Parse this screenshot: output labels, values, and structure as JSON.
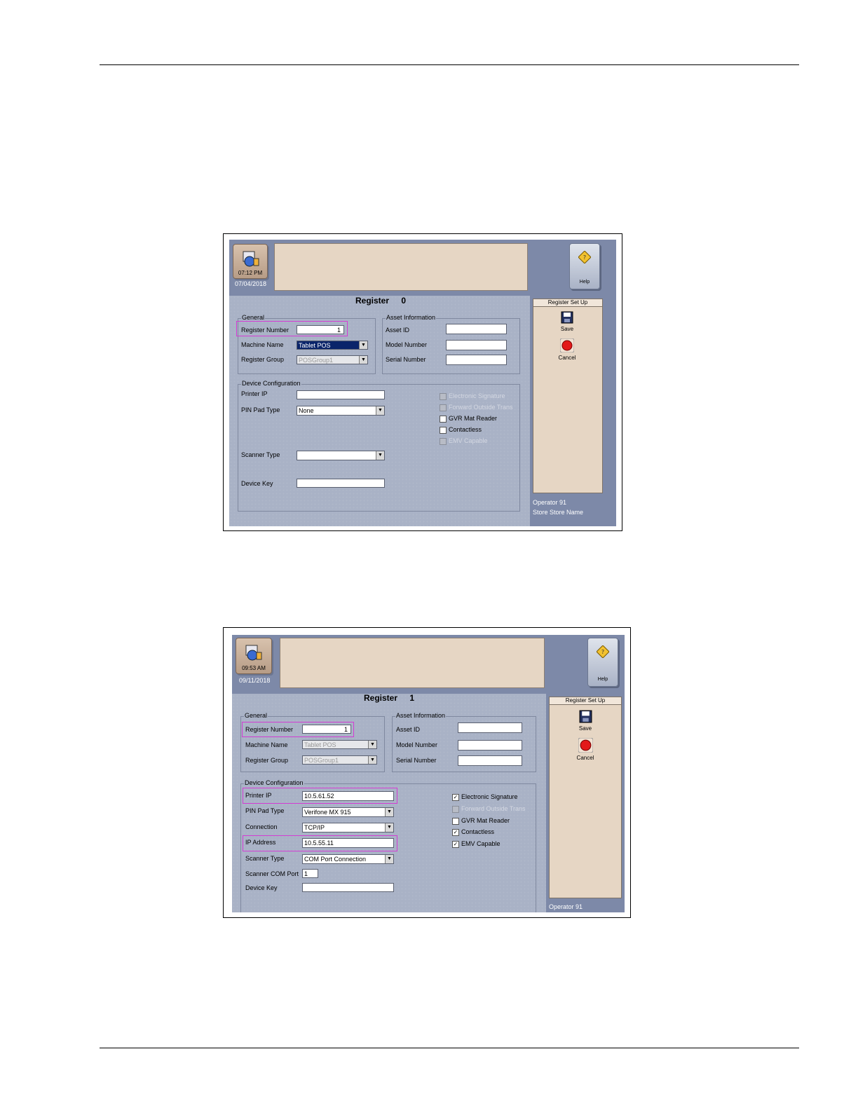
{
  "screen1": {
    "clock_time": "07:12 PM",
    "date": "07/04/2018",
    "help_label": "Help",
    "title_label": "Register",
    "title_number": "0",
    "general_group": "General",
    "asset_group": "Asset Information",
    "device_group": "Device Configuration",
    "register_number_label": "Register Number",
    "register_number_value": "1",
    "machine_name_label": "Machine Name",
    "machine_name_value": "Tablet POS",
    "register_group_label": "Register Group",
    "register_group_value": "POSGroup1",
    "asset_id_label": "Asset ID",
    "model_number_label": "Model Number",
    "serial_number_label": "Serial Number",
    "printer_ip_label": "Printer IP",
    "pin_pad_type_label": "PIN Pad Type",
    "pin_pad_type_value": "None",
    "scanner_type_label": "Scanner Type",
    "device_key_label": "Device Key",
    "electronic_signature_label": "Electronic Signature",
    "forward_outside_trans_label": "Forward Outside Trans",
    "gvr_mat_reader_label": "GVR Mat Reader",
    "contactless_label": "Contactless",
    "emv_capable_label": "EMV Capable",
    "side_title": "Register Set Up",
    "save_label": "Save",
    "cancel_label": "Cancel",
    "operator": "Operator 91",
    "store": "Store Store Name"
  },
  "screen2": {
    "clock_time": "09:53 AM",
    "date": "09/11/2018",
    "help_label": "Help",
    "title_label": "Register",
    "title_number": "1",
    "general_group": "General",
    "asset_group": "Asset Information",
    "device_group": "Device Configuration",
    "register_number_label": "Register Number",
    "register_number_value": "1",
    "machine_name_label": "Machine Name",
    "machine_name_value": "Tablet POS",
    "register_group_label": "Register Group",
    "register_group_value": "POSGroup1",
    "asset_id_label": "Asset ID",
    "model_number_label": "Model Number",
    "serial_number_label": "Serial Number",
    "printer_ip_label": "Printer IP",
    "printer_ip_value": "10.5.61.52",
    "pin_pad_type_label": "PIN Pad Type",
    "pin_pad_type_value": "Verifone MX 915",
    "connection_label": "Connection",
    "connection_value": "TCP/IP",
    "ip_address_label": "IP Address",
    "ip_address_value": "10.5.55.11",
    "scanner_type_label": "Scanner Type",
    "scanner_type_value": "COM Port Connection",
    "scanner_com_port_label": "Scanner COM Port",
    "scanner_com_port_value": "1",
    "device_key_label": "Device Key",
    "electronic_signature_label": "Electronic Signature",
    "forward_outside_trans_label": "Forward Outside Trans",
    "gvr_mat_reader_label": "GVR Mat Reader",
    "contactless_label": "Contactless",
    "emv_capable_label": "EMV Capable",
    "side_title": "Register Set Up",
    "save_label": "Save",
    "cancel_label": "Cancel",
    "operator": "Operator 91"
  },
  "colors": {
    "highlight": "#d33cd3",
    "screen_bg": "#a9b2c6",
    "panel_tan": "#e6d6c4"
  }
}
